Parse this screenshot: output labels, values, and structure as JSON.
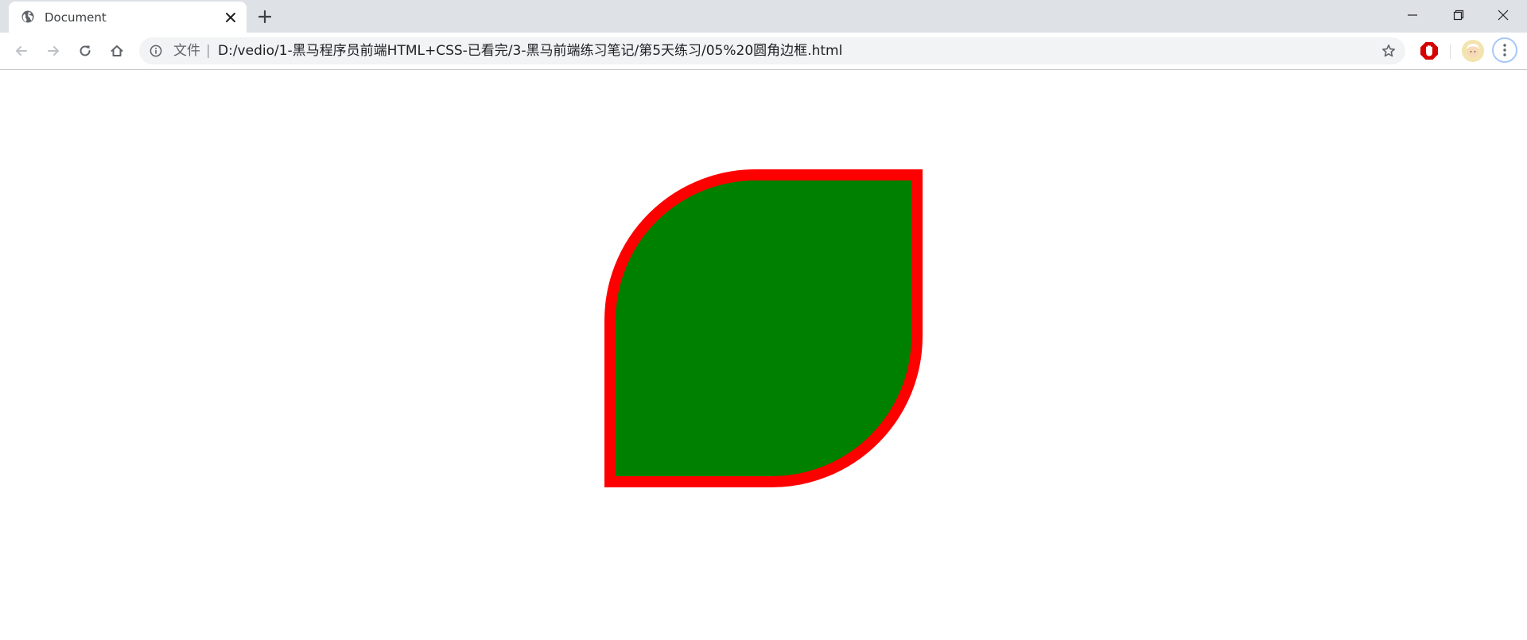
{
  "browser": {
    "tab": {
      "title": "Document",
      "favicon_icon": "globe-icon",
      "close_icon": "close-icon"
    },
    "new_tab_icon": "plus-icon",
    "window_controls": [
      "minimize-icon",
      "restore-icon",
      "close-icon"
    ],
    "toolbar": {
      "back_icon": "arrow-left-icon",
      "forward_icon": "arrow-right-icon",
      "reload_icon": "reload-icon",
      "home_icon": "home-icon"
    },
    "omnibox": {
      "info_icon": "info-icon",
      "site_label": "文件",
      "separator": "|",
      "url": "D:/vedio/1-黑马程序员前端HTML+CSS-已看完/3-黑马前端练习笔记/第5天练习/05%20圆角边框.html",
      "bookmark_icon": "star-icon"
    },
    "extension_icon": "stop-hand-icon",
    "profile_icon": "avatar-icon",
    "menu_icon": "more-vertical-icon"
  },
  "page": {
    "shape": {
      "fill_color": "#008000",
      "border_color": "#ff0000"
    }
  }
}
